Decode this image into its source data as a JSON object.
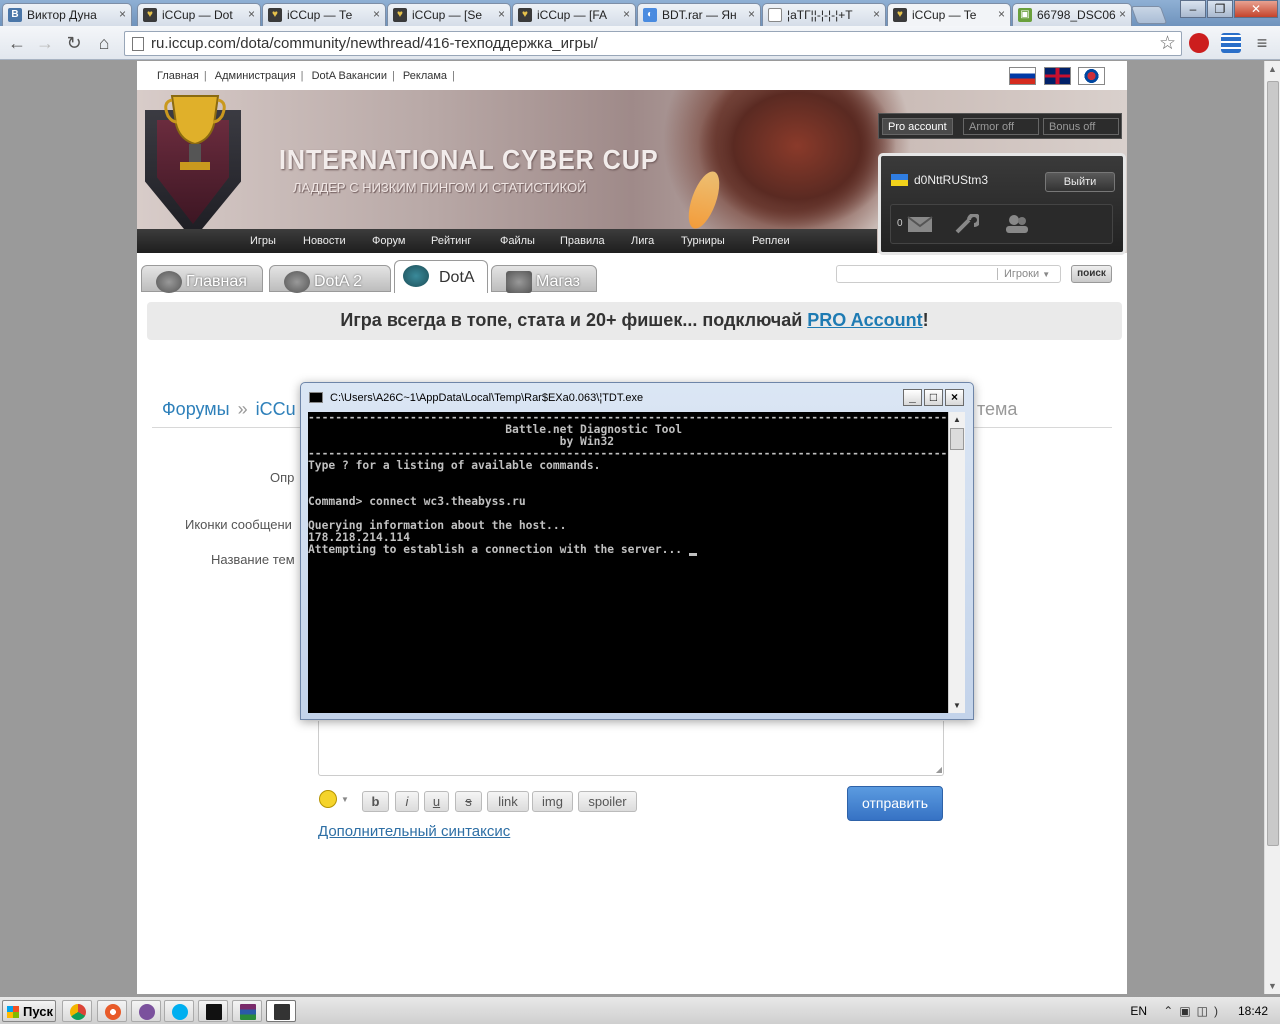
{
  "browser": {
    "tabs": [
      {
        "label": "Виктор Дуна",
        "icon": "vk-icon",
        "color": "#4a76a8"
      },
      {
        "label": "iCCup — Dot",
        "icon": "iccup-icon",
        "color": "#3a3a3a"
      },
      {
        "label": "iCCup — Те",
        "icon": "iccup-icon",
        "color": "#3a3a3a"
      },
      {
        "label": "iCCup — [Se",
        "icon": "iccup-icon",
        "color": "#3a3a3a"
      },
      {
        "label": "iCCup — [FA",
        "icon": "iccup-icon",
        "color": "#3a3a3a"
      },
      {
        "label": "BDT.rar — Ян",
        "icon": "yandex-disk-icon",
        "color": "#4a8be0"
      },
      {
        "label": "¦аТГ¦¦-¦-¦-¦+Т",
        "icon": "document-icon",
        "color": "#ffffff"
      },
      {
        "label": "iCCup — Te",
        "icon": "iccup-icon",
        "color": "#3a3a3a"
      },
      {
        "label": "66798_DSC06",
        "icon": "image-icon",
        "color": "#6aa03c"
      }
    ],
    "active_tab": 7,
    "url": "ru.iccup.com/dota/community/newthread/416-техподдержка_игры/"
  },
  "site": {
    "topnav": [
      "Главная",
      "Администрация",
      "DotA Вакансии",
      "Реклама"
    ],
    "flags": [
      "russian-flag-icon",
      "english-flag-icon",
      "korean-flag-icon"
    ],
    "banner_title": "INTERNATIONAL CYBER CUP",
    "banner_subtitle": "ЛАДДЕР С НИЗКИМ ПИНГОМ И СТАТИСТИКОЙ",
    "mainnav": [
      "Игры",
      "Новости",
      "Форум",
      "Рейтинг",
      "Файлы",
      "Правила",
      "Лига",
      "Турниры",
      "Реплеи"
    ],
    "pro_toggles": [
      {
        "label": "Pro account",
        "state": "on"
      },
      {
        "label": "Armor off",
        "state": "off"
      },
      {
        "label": "Bonus off",
        "state": "off"
      }
    ],
    "user": {
      "name": "d0NttRUStm3",
      "logout": "Выйти",
      "messages": "0"
    },
    "game_tabs": [
      {
        "label": "Главная"
      },
      {
        "label": "DotA 2"
      },
      {
        "label": "DotA",
        "active": true
      },
      {
        "label": "Магаз"
      }
    ],
    "search": {
      "placeholder": "",
      "category": "Игроки",
      "button": "поиск"
    },
    "ad": {
      "text": "Игра всегда в топе, стата и 20+ фишек... подключай ",
      "link": "PRO Account",
      "suffix": "!"
    },
    "breadcrumb": {
      "first": "Форумы",
      "sep": "»",
      "second": "iCCu",
      "right": "тема"
    },
    "form": {
      "label_1": "Опр",
      "label_2": "Иконки сообщени",
      "label_3": "Название тем",
      "buttons": [
        "b",
        "i",
        "u",
        "s",
        "link",
        "img",
        "spoiler"
      ],
      "send": "отправить",
      "syntax_link": "Дополнительный синтаксис"
    }
  },
  "console": {
    "title": "C:\\Users\\A26C~1\\AppData\\Local\\Temp\\Rar$EXa0.063\\¦TDT.exe",
    "rule": "------------------------------------------------------------------------------------------------------------------",
    "header_line_1": "                             Battle.net Diagnostic Tool",
    "header_line_2": "                                     by Win32",
    "line_help": "Type ? for a listing of available commands.",
    "line_command": "Command> connect wc3.theabyss.ru",
    "line_query": "Querying information about the host...",
    "line_ip": "178.218.214.114",
    "line_attempt": "Attempting to establish a connection with the server... "
  },
  "taskbar": {
    "start": "Пуск",
    "apps": [
      "chrome-icon",
      "orbit-icon",
      "viber-icon",
      "skype-icon",
      "terminal-icon",
      "winrar-icon",
      "console-window-icon"
    ],
    "lang": "EN",
    "time": "18:42"
  }
}
